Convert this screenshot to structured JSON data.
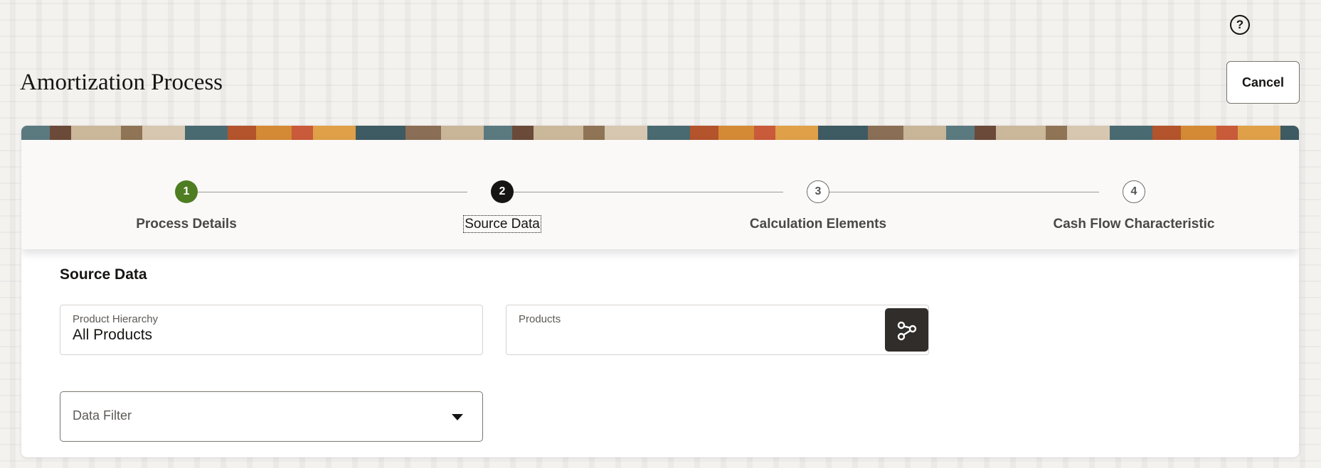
{
  "header": {
    "title": "Amortization Process",
    "cancel_label": "Cancel",
    "help_icon": "question-circle-icon"
  },
  "stepper": {
    "steps": [
      {
        "number": "1",
        "label": "Process Details",
        "state": "completed"
      },
      {
        "number": "2",
        "label": "Source Data",
        "state": "current"
      },
      {
        "number": "3",
        "label": "Calculation Elements",
        "state": "upcoming"
      },
      {
        "number": "4",
        "label": "Cash Flow Characteristic",
        "state": "upcoming"
      }
    ]
  },
  "source_data": {
    "title": "Source Data",
    "product_hierarchy": {
      "label": "Product Hierarchy",
      "value": "All Products"
    },
    "products": {
      "label": "Products",
      "value": "",
      "button_icon": "hierarchy-icon"
    },
    "data_filter": {
      "label": "Data Filter",
      "value": ""
    }
  },
  "colors": {
    "completed": "#4f7d22",
    "current": "#161513",
    "hierarchy_button": "#312d2a"
  }
}
